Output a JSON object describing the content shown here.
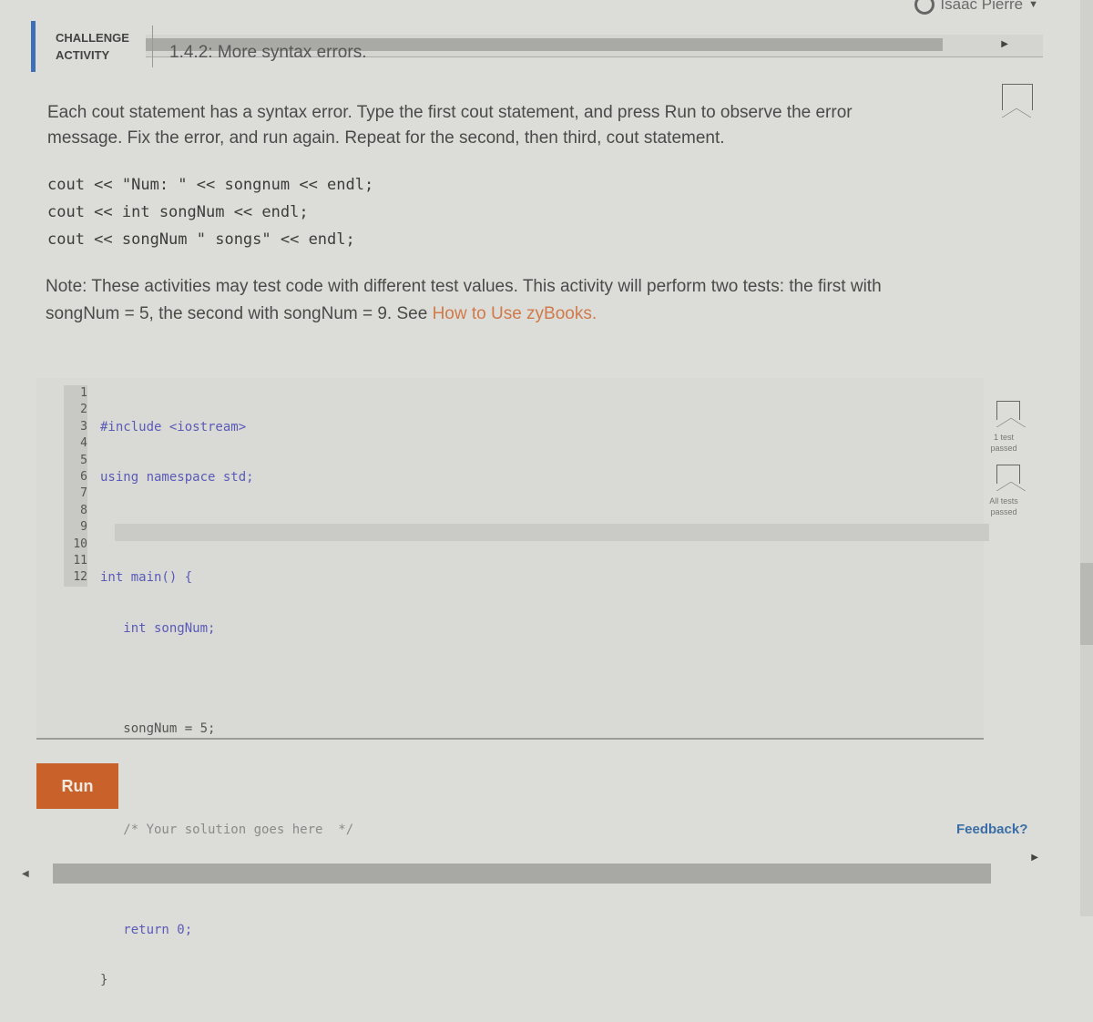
{
  "header": {
    "user_name": "Isaac Pierre",
    "activity_type_line1": "CHALLENGE",
    "activity_type_line2": "ACTIVITY",
    "activity_title": "1.4.2: More syntax errors."
  },
  "instructions": {
    "text": "Each cout statement has a syntax error. Type the first cout statement, and press Run to observe the error message. Fix the error, and run again. Repeat for the second, then third, cout statement.",
    "code_lines": [
      "cout << \"Num: \" << songnum << endl;",
      "cout << int songNum << endl;",
      "cout << songNum \" songs\" << endl;"
    ],
    "note_text": "Note: These activities may test code with different test values. This activity will perform two tests: the first with songNum = 5, the second with songNum = 9. See ",
    "note_link": "How to Use zyBooks."
  },
  "editor": {
    "line_numbers": [
      "1",
      "2",
      "3",
      "4",
      "5",
      "6",
      "7",
      "8",
      "9",
      "10",
      "11",
      "12"
    ],
    "lines": [
      "#include <iostream>",
      "using namespace std;",
      "",
      "int main() {",
      "   int songNum;",
      "",
      "   songNum = 5;",
      "",
      "   /* Your solution goes here  */",
      "",
      "   return 0;",
      "}"
    ]
  },
  "status": {
    "test1_label": "1 test passed",
    "all_label": "All tests passed"
  },
  "actions": {
    "run_label": "Run",
    "feedback_label": "Feedback?"
  },
  "icons": {
    "scroll_left": "◀",
    "scroll_right": "▶",
    "caret_down": "▼"
  }
}
